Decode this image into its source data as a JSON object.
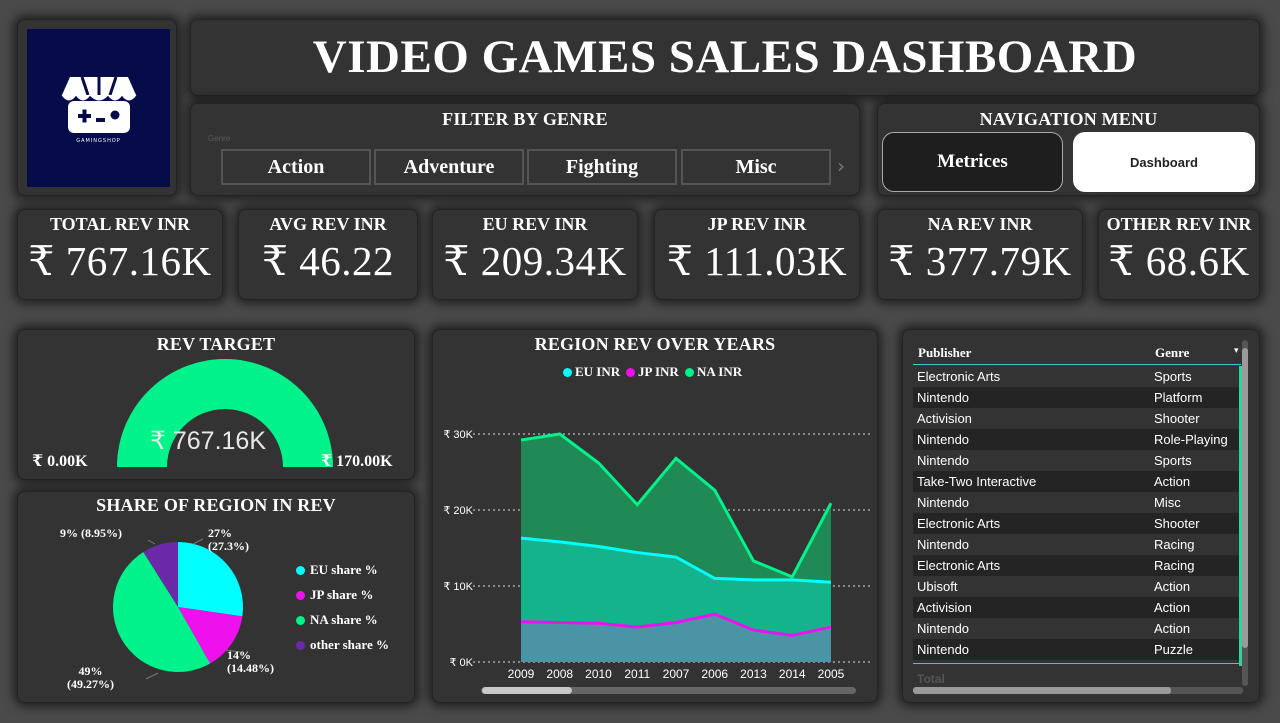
{
  "header": {
    "title": "VIDEO GAMES SALES DASHBOARD",
    "logo_text": "GAMINGSHOP"
  },
  "filter": {
    "title": "FILTER BY GENRE",
    "caption": "Genre",
    "options": [
      "Action",
      "Adventure",
      "Fighting",
      "Misc"
    ]
  },
  "nav": {
    "title": "NAVIGATION MENU",
    "metrics_label": "Metrices",
    "dashboard_label": "Dashboard"
  },
  "kpis": [
    {
      "label": "TOTAL REV INR",
      "value": "₹ 767.16K"
    },
    {
      "label": "AVG REV INR",
      "value": "₹ 46.22"
    },
    {
      "label": "EU REV INR",
      "value": "₹ 209.34K"
    },
    {
      "label": "JP REV INR",
      "value": "₹ 111.03K"
    },
    {
      "label": "NA REV INR",
      "value": "₹ 377.79K"
    },
    {
      "label": "OTHER REV INR",
      "value": "₹ 68.6K"
    }
  ],
  "gauge": {
    "title": "REV TARGET",
    "min_label": "₹ 0.00K",
    "max_label": "₹ 170.00K",
    "value_label": "₹ 767.16K",
    "fill_fraction": 1.0,
    "color": "#00f28a"
  },
  "chart_data": [
    {
      "type": "pie",
      "title": "SHARE OF REGION IN REV",
      "series": [
        {
          "name": "EU share %",
          "value": 27.3,
          "label_top": "27%",
          "label_bottom": "(27.3%)",
          "color": "#00ffff"
        },
        {
          "name": "JP share %",
          "value": 14.48,
          "label_top": "14%",
          "label_bottom": "(14.48%)",
          "color": "#ee11ee"
        },
        {
          "name": "NA share %",
          "value": 49.27,
          "label_top": "49%",
          "label_bottom": "(49.27%)",
          "color": "#00f28a"
        },
        {
          "name": "other share %",
          "value": 8.95,
          "label_top": "9% (8.95%)",
          "label_bottom": "",
          "color": "#6a2aa8"
        }
      ]
    },
    {
      "type": "area",
      "title": "REGION REV OVER YEARS",
      "categories": [
        "2009",
        "2008",
        "2010",
        "2011",
        "2007",
        "2006",
        "2013",
        "2014",
        "2005"
      ],
      "y_ticks": [
        "₹ 0K",
        "₹ 10K",
        "₹ 20K",
        "₹ 30K"
      ],
      "ylim": [
        0,
        30000
      ],
      "series": [
        {
          "name": "EU INR",
          "color": "#00ffff",
          "values": [
            16300,
            15800,
            15200,
            14400,
            13800,
            11000,
            10800,
            10800,
            10500
          ]
        },
        {
          "name": "JP INR",
          "color": "#ee11ee",
          "values": [
            5300,
            5200,
            5100,
            4600,
            5200,
            6300,
            4200,
            3500,
            4600
          ]
        },
        {
          "name": "NA INR",
          "color": "#00f28a",
          "values": [
            29200,
            30000,
            26200,
            20700,
            26800,
            22600,
            13300,
            11200,
            20900
          ]
        }
      ]
    }
  ],
  "table": {
    "columns": [
      "Publisher",
      "Genre"
    ],
    "rows": [
      [
        "Electronic Arts",
        "Sports"
      ],
      [
        "Nintendo",
        "Platform"
      ],
      [
        "Activision",
        "Shooter"
      ],
      [
        "Nintendo",
        "Role-Playing"
      ],
      [
        "Nintendo",
        "Sports"
      ],
      [
        "Take-Two Interactive",
        "Action"
      ],
      [
        "Nintendo",
        "Misc"
      ],
      [
        "Electronic Arts",
        "Shooter"
      ],
      [
        "Nintendo",
        "Racing"
      ],
      [
        "Electronic Arts",
        "Racing"
      ],
      [
        "Ubisoft",
        "Action"
      ],
      [
        "Activision",
        "Action"
      ],
      [
        "Nintendo",
        "Action"
      ],
      [
        "Nintendo",
        "Puzzle"
      ]
    ],
    "total_label": "Total"
  }
}
